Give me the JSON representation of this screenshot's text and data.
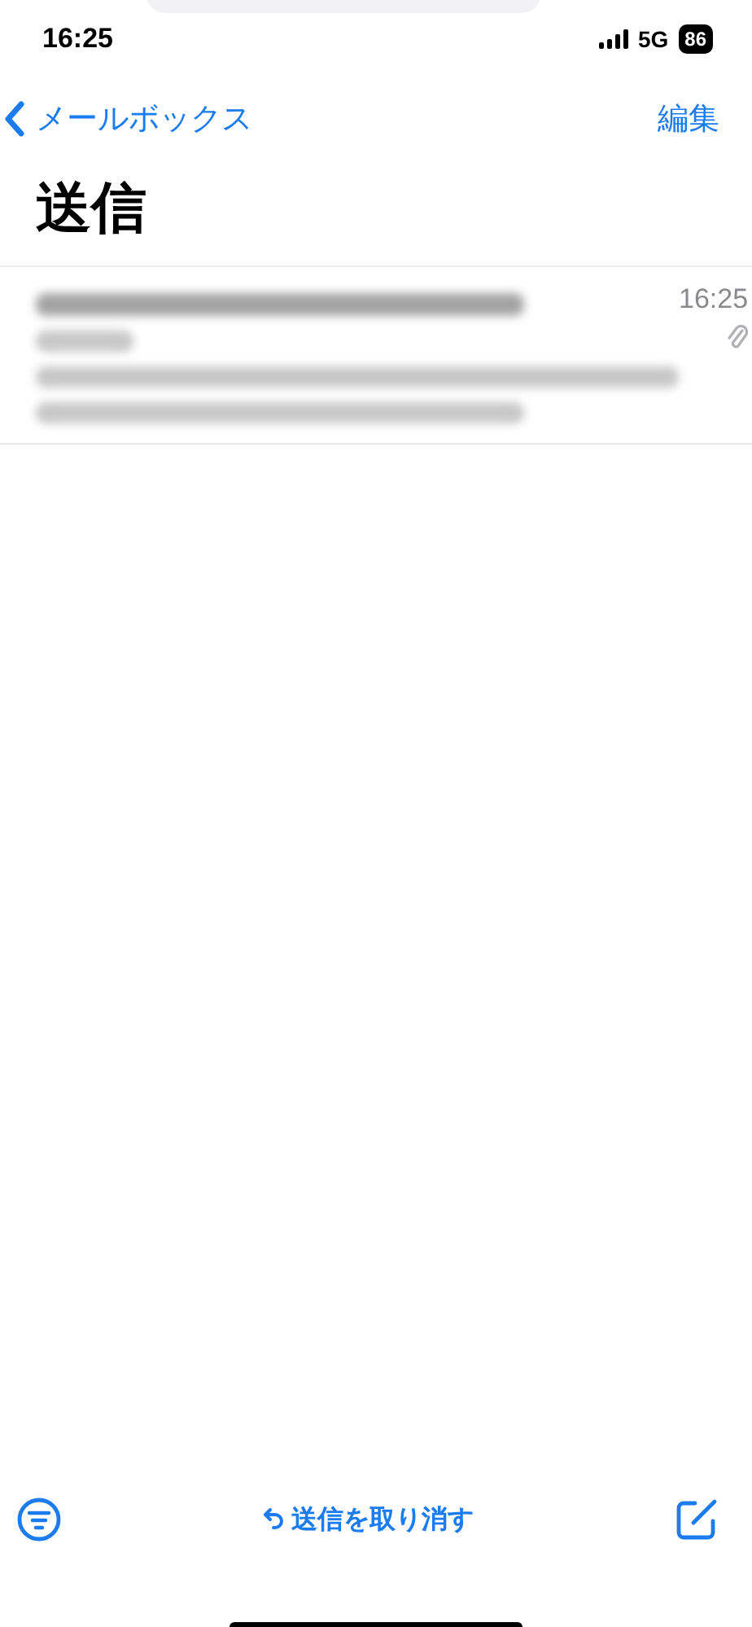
{
  "status_bar": {
    "time": "16:25",
    "network": "5G",
    "battery": "86"
  },
  "nav": {
    "back_label": "メールボックス",
    "edit": "編集"
  },
  "title": "送信",
  "messages": [
    {
      "time": "16:25",
      "attachment": true,
      "blurred": true
    }
  ],
  "toolbar": {
    "undo_label": "送信を取り消す"
  }
}
